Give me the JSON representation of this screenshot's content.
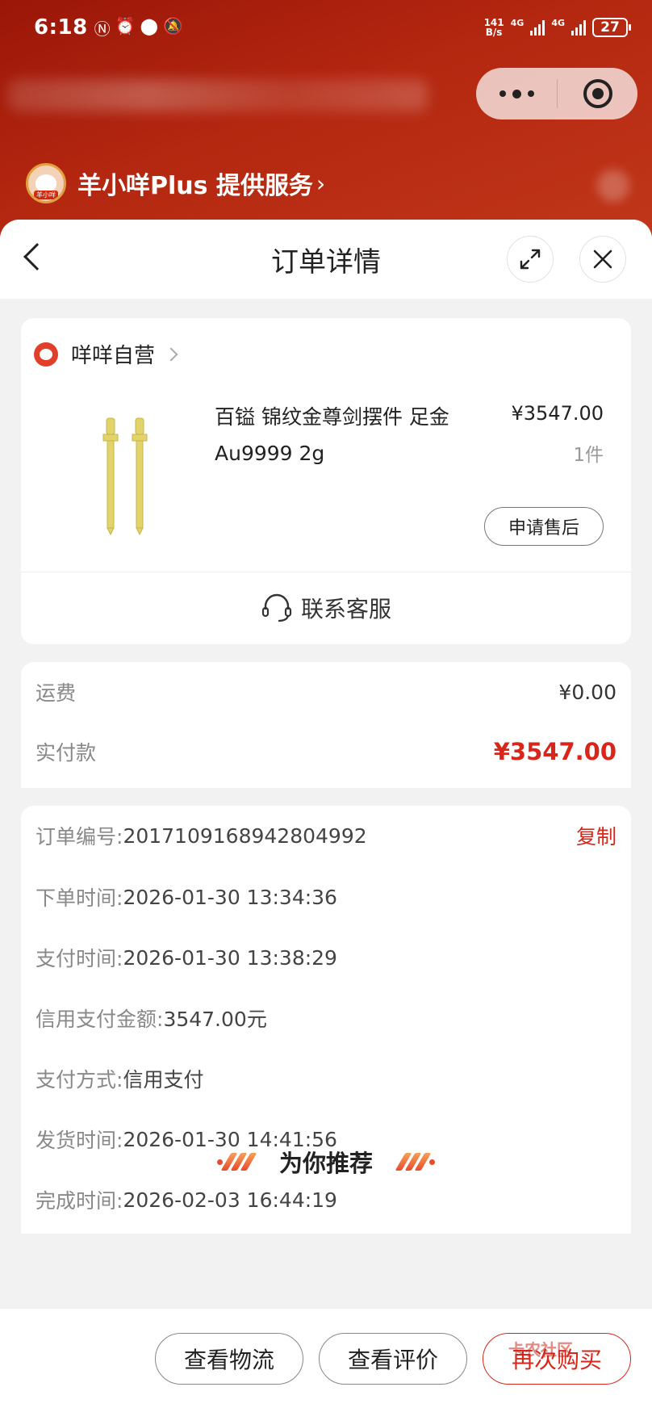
{
  "status_bar": {
    "time": "6:18",
    "net_speed_top": "141",
    "net_speed_bottom": "B/s",
    "net1": "4G",
    "net2": "4G",
    "battery": "27"
  },
  "provider": {
    "logo_tag": "羊小咩",
    "text": "羊小咩Plus 提供服务",
    "chevron": "›"
  },
  "header": {
    "title": "订单详情"
  },
  "store": {
    "name": "咩咩自营",
    "product": {
      "title": "百镒 锦纹金尊剑摆件 足金Au9999 2g",
      "price": "¥3547.00",
      "quantity": "1件",
      "after_sale_label": "申请售后"
    },
    "service_label": "联系客服"
  },
  "fees": {
    "shipping_label": "运费",
    "shipping_value": "¥0.00",
    "paid_label": "实付款",
    "paid_value": "¥3547.00"
  },
  "order_info": {
    "order_no_label": "订单编号:",
    "order_no": "2017109168942804992",
    "copy_label": "复制",
    "order_time_label": "下单时间:",
    "order_time": "2026-01-30 13:34:36",
    "pay_time_label": "支付时间:",
    "pay_time": "2026-01-30 13:38:29",
    "credit_amount_label": "信用支付金额:",
    "credit_amount": "3547.00元",
    "pay_method_label": "支付方式:",
    "pay_method": "信用支付",
    "ship_time_label": "发货时间:",
    "ship_time": "2026-01-30 14:41:56",
    "done_time_label": "完成时间:",
    "done_time": "2026-02-03 16:44:19"
  },
  "recommend": {
    "title": "为你推荐"
  },
  "bottom": {
    "logistics_label": "查看物流",
    "review_label": "查看评价",
    "rebuy_label": "再次购买"
  },
  "watermark": "卡农社区",
  "colors": {
    "accent_red": "#d8261a",
    "header_bg": "#b42710"
  }
}
